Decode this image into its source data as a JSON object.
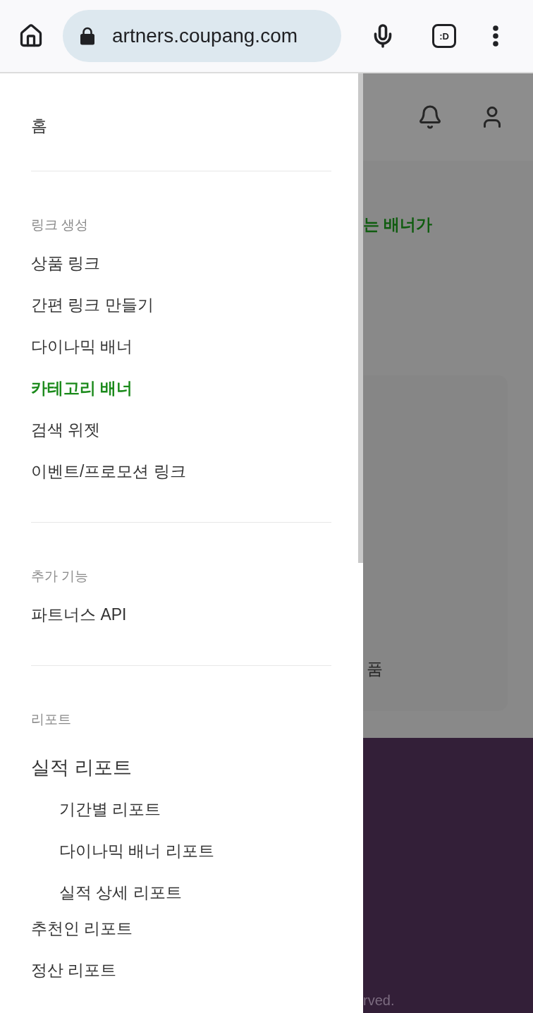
{
  "browser": {
    "url": "artners.coupang.com",
    "tab_switcher": ":D"
  },
  "drawer": {
    "home": {
      "label": "홈",
      "selected": false
    },
    "sections": [
      {
        "title": "링크 생성",
        "items": [
          {
            "label": "상품 링크",
            "selected": false
          },
          {
            "label": "간편 링크 만들기",
            "selected": false
          },
          {
            "label": "다이나믹 배너",
            "selected": false
          },
          {
            "label": "카테고리 배너",
            "selected": true
          },
          {
            "label": "검색 위젯",
            "selected": false
          },
          {
            "label": "이벤트/프로모션 링크",
            "selected": false
          }
        ]
      },
      {
        "title": "추가 기능",
        "items": [
          {
            "label": "파트너스 API",
            "selected": false
          }
        ]
      },
      {
        "title": "리포트",
        "items": [
          {
            "label": "실적 리포트",
            "selected": false,
            "children": [
              {
                "label": "기간별 리포트",
                "selected": false
              },
              {
                "label": "다이나믹 배너 리포트",
                "selected": false
              },
              {
                "label": "실적 상세 리포트",
                "selected": false
              }
            ]
          },
          {
            "label": "추천인 리포트",
            "selected": false
          },
          {
            "label": "정산 리포트",
            "selected": false
          }
        ]
      }
    ]
  },
  "page": {
    "banner_text": "는 배너가",
    "card_text": "품",
    "footer_text": "rved."
  }
}
